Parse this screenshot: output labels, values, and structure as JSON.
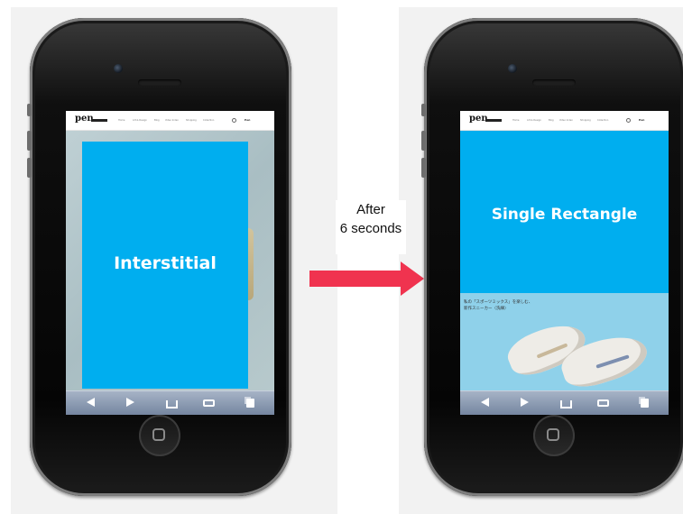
{
  "left_phone": {
    "site_logo": "pen",
    "nav_items": [
      "Home",
      "Art & Design",
      "Blog",
      "Video Index",
      "Shopping",
      "Collection"
    ],
    "header_brand": "Pen",
    "ad_label": "Interstitial"
  },
  "right_phone": {
    "site_logo": "pen",
    "nav_items": [
      "Home",
      "Art & Design",
      "Blog",
      "Video Index",
      "Shopping",
      "Collection"
    ],
    "header_brand": "Pen",
    "ad_label": "Single Rectangle",
    "article_caption_line1": "私の「スポーツミックス」を楽しむ、",
    "article_caption_line2": "新作スニーカー（洗練）"
  },
  "transition": {
    "line1": "After",
    "line2": "6 seconds"
  },
  "colors": {
    "ad_blue": "#00aeef",
    "arrow_red": "#f0334f"
  },
  "icons": [
    "back-icon",
    "forward-icon",
    "share-icon",
    "bookmarks-icon",
    "tabs-icon",
    "search-icon"
  ]
}
